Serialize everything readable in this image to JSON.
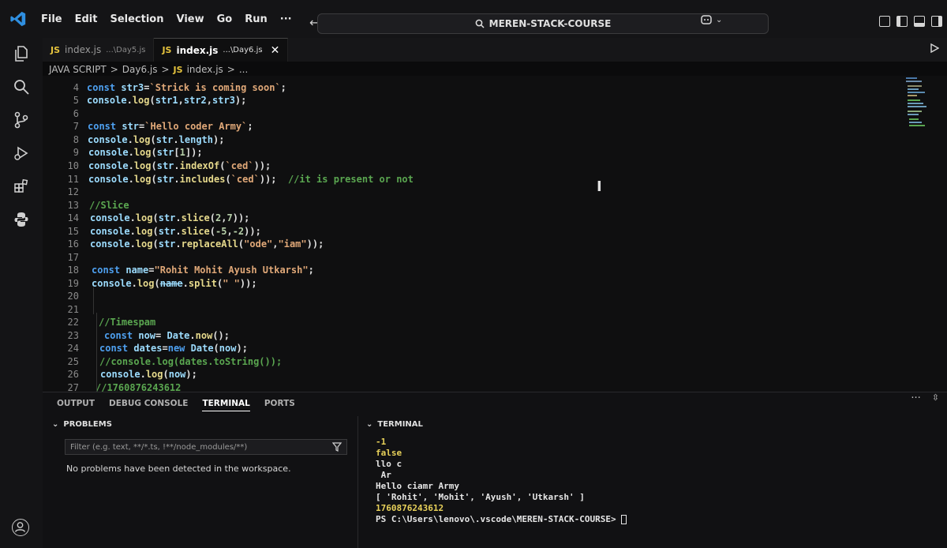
{
  "titlebar": {
    "menu": [
      "File",
      "Edit",
      "Selection",
      "View",
      "Go",
      "Run",
      "···"
    ],
    "search": "MEREN-STACK-COURSE"
  },
  "tabs": [
    {
      "badge": "JS",
      "name": "index.js",
      "path": "...\\Day5.js",
      "active": false
    },
    {
      "badge": "JS",
      "name": "index.js",
      "path": "...\\Day6.js",
      "active": true,
      "close": "✕"
    }
  ],
  "breadcrumb": [
    "JAVA SCRIPT",
    ">",
    "Day6.js",
    ">",
    "JS",
    "index.js",
    ">",
    "..."
  ],
  "editor": {
    "lines": [
      {
        "n": "4"
      },
      {
        "n": "5"
      },
      {
        "n": "6"
      },
      {
        "n": "7"
      },
      {
        "n": "8"
      },
      {
        "n": "9"
      },
      {
        "n": "10"
      },
      {
        "n": "11"
      },
      {
        "n": "12"
      },
      {
        "n": "13"
      },
      {
        "n": "14"
      },
      {
        "n": "15"
      },
      {
        "n": "16"
      },
      {
        "n": "17"
      },
      {
        "n": "18"
      },
      {
        "n": "19"
      },
      {
        "n": "20"
      },
      {
        "n": "21"
      },
      {
        "n": "22"
      },
      {
        "n": "23"
      },
      {
        "n": "24"
      },
      {
        "n": "25"
      },
      {
        "n": "26"
      },
      {
        "n": "27"
      }
    ]
  },
  "panel": {
    "tabs": [
      "OUTPUT",
      "DEBUG CONSOLE",
      "TERMINAL",
      "PORTS"
    ],
    "active_tab": "TERMINAL",
    "problems_title": "PROBLEMS",
    "filter_placeholder": "Filter (e.g. text, **/*.ts, !**/node_modules/**)",
    "no_problems": "No problems have been detected in the workspace.",
    "terminal_title": "TERMINAL",
    "terminal_lines": [
      {
        "text": "-1",
        "color": "yellow"
      },
      {
        "text": "false",
        "color": "yellow"
      },
      {
        "text": "llo c",
        "color": "white"
      },
      {
        "text": " Ar",
        "color": "white"
      },
      {
        "text": "Hello ciamr Army",
        "color": "white"
      },
      {
        "text": "[ 'Rohit', 'Mohit', 'Ayush', 'Utkarsh' ]",
        "color": "mixed"
      },
      {
        "text": "1760876243612",
        "color": "yellow"
      }
    ],
    "prompt": "PS C:\\Users\\lenovo\\.vscode\\MEREN-STACK-COURSE> "
  }
}
